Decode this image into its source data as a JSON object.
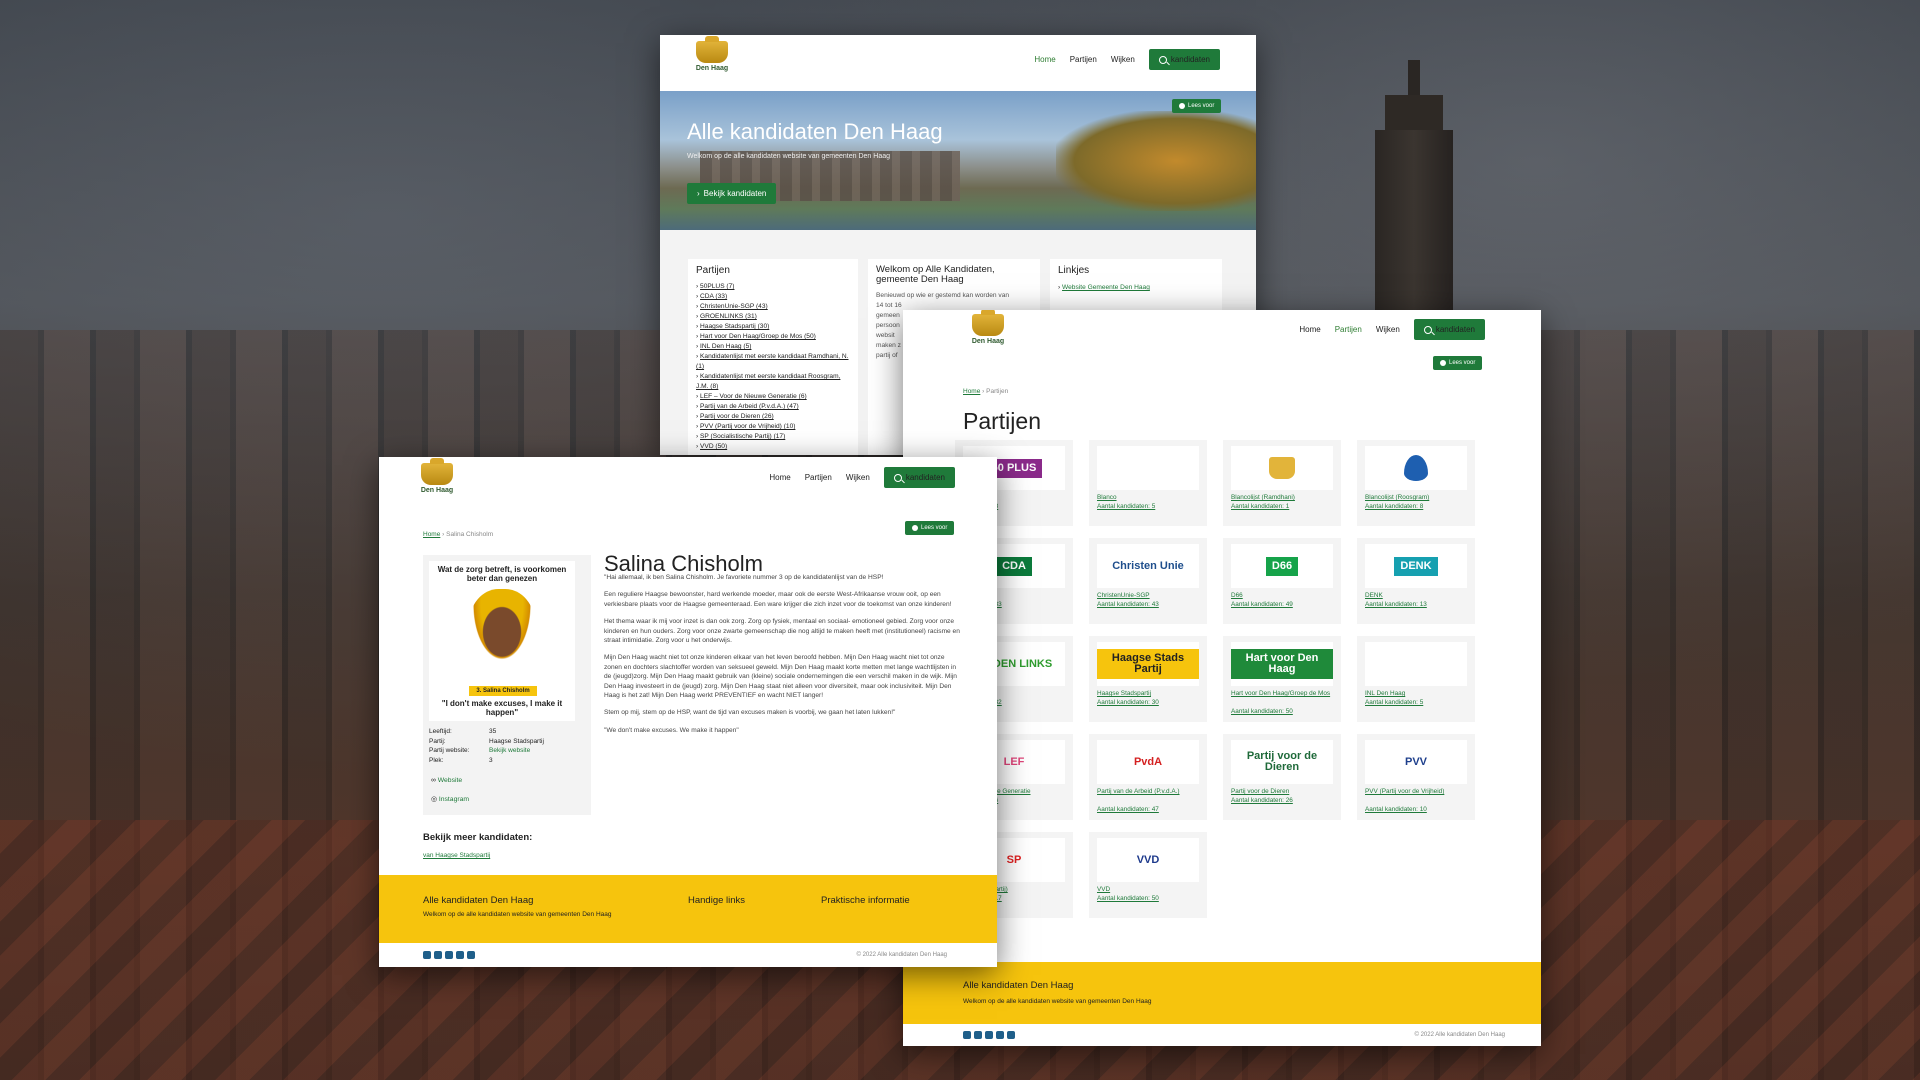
{
  "brand": {
    "logo_text": "Den Haag",
    "accent": "#1f7a3a",
    "footer_color": "#f6c40d"
  },
  "nav": {
    "home": "Home",
    "partijen": "Partijen",
    "wijken": "Wijken",
    "search_button": "kandidaten",
    "lees_voor": "Lees voor"
  },
  "home_page": {
    "hero_title": "Alle kandidaten Den Haag",
    "hero_sub": "Welkom op de alle kandidaten website van gemeenten Den Haag",
    "hero_button": "Bekijk kandidaten",
    "partijen_title": "Partijen",
    "party_list": [
      "50PLUS (7)",
      "CDA (33)",
      "ChristenUnie-SGP (43)",
      "GROENLINKS (31)",
      "Haagse Stadspartij (30)",
      "Hart voor Den Haag/Groep de Mos (50)",
      "INL Den Haag (5)",
      "Kandidatenlijst met eerste kandidaat Ramdhani, N. (1)",
      "Kandidatenlijst met eerste kandidaat Roosgram, J.M. (8)",
      "LEF – Voor de Nieuwe Generatie (6)",
      "Partij van de Arbeid (P.v.d.A.) (47)",
      "Partij voor de Dieren (26)",
      "PVV (Partij voor de Vrijheid) (10)",
      "SP (Socialistische Partij) (17)",
      "VVD (50)"
    ],
    "welkom_title": "Welkom op Alle Kandidaten, gemeente Den Haag",
    "welkom_text": [
      "Benieuwd op wie er gestemd kan worden van",
      "14 tot 16",
      "gemeen",
      "persoon",
      "websit",
      "maken z",
      "partij of"
    ],
    "linkjes_title": "Linkjes",
    "linkjes": [
      "Website Gemeente Den Haag"
    ]
  },
  "partijen_page": {
    "breadcrumb_home": "Home",
    "breadcrumb_current": "Partijen",
    "title": "Partijen",
    "parties": [
      {
        "logo": "50 PLUS",
        "name": "",
        "count": "andidaten: 8"
      },
      {
        "logo": "",
        "name": "Blanco",
        "count": "Aantal kandidaten: 5"
      },
      {
        "logo": "crest",
        "name": "Blancolijst (Ramdhani)",
        "count": "Aantal kandidaten: 1"
      },
      {
        "logo": "flame",
        "name": "Blancolijst (Roosgram)",
        "count": "Aantal kandidaten: 8"
      },
      {
        "logo": "CDA",
        "name": "",
        "count": "andidaten: 33"
      },
      {
        "logo": "Christen Unie",
        "name": "ChristenUnie-SGP",
        "count": "Aantal kandidaten: 43"
      },
      {
        "logo": "D66",
        "name": "D66",
        "count": "Aantal kandidaten: 49"
      },
      {
        "logo": "DENK",
        "name": "DENK",
        "count": "Aantal kandidaten: 13"
      },
      {
        "logo": "GROEN LINKS",
        "name": "LINKS",
        "count": "andidaten: 32"
      },
      {
        "logo": "Haagse Stads Partij",
        "name": "Haagse Stadspartij",
        "count": "Aantal kandidaten: 30"
      },
      {
        "logo": "Hart voor Den Haag",
        "name": "Hart voor Den Haag/Groep de Mos",
        "count": "Aantal kandidaten: 50"
      },
      {
        "logo": "",
        "name": "INL Den Haag",
        "count": "Aantal kandidaten: 5"
      },
      {
        "logo": "LEF",
        "name": "or de Nieuwe Generatie",
        "count": "andidaten: 6"
      },
      {
        "logo": "PvdA",
        "name": "Partij van de Arbeid (P.v.d.A.)",
        "count": "Aantal kandidaten: 47"
      },
      {
        "logo": "Partij voor de Dieren",
        "name": "Partij voor de Dieren",
        "count": "Aantal kandidaten: 26"
      },
      {
        "logo": "PVV",
        "name": "PVV (Partij voor de Vrijheid)",
        "count": "Aantal kandidaten: 10"
      },
      {
        "logo": "SP",
        "name": "alistische Partij)",
        "count": "andidaten: 17"
      },
      {
        "logo": "VVD",
        "name": "VVD",
        "count": "Aantal kandidaten: 50"
      }
    ],
    "footer_title": "Alle kandidaten Den Haag",
    "footer_sub": "Welkom op de alle kandidaten website van gemeenten Den Haag",
    "copyright": "© 2022 Alle kandidaten Den Haag"
  },
  "candidate_page": {
    "breadcrumb_home": "Home",
    "breadcrumb_current": "Salina Chisholm",
    "poster_top": "Wat de zorg betreft, is voorkomen beter dan genezen",
    "poster_tag": "3. Salina Chisholm",
    "poster_quote": "\"I don't make excuses, I make it happen\"",
    "details": [
      {
        "label": "Leeftijd:",
        "value": "35"
      },
      {
        "label": "Partij:",
        "value": "Haagse Stadspartij"
      },
      {
        "label": "Partij website:",
        "value": "Bekijk website"
      },
      {
        "label": "Plek:",
        "value": "3"
      }
    ],
    "website_link": "Website",
    "instagram_link": "Instagram",
    "name": "Salina Chisholm",
    "paragraphs": [
      "\"Hai allemaal, ik ben Salina Chisholm. Je favoriete nummer 3 op de kandidatenlijst van de HSP!",
      "Een reguliere Haagse bewoonster, hard werkende moeder, maar ook de eerste West-Afrikaanse vrouw ooit, op een verkiesbare plaats voor de Haagse gemeenteraad. Een ware krijger die zich inzet voor de toekomst van onze kinderen!",
      "Het thema waar ik mij voor inzet is dan ook zorg. Zorg op fysiek, mentaal en sociaal- emotioneel gebied. Zorg voor onze kinderen en hun ouders. Zorg voor onze zwarte gemeenschap die nog altijd te maken heeft met (institutioneel) racisme en straat intimidatie. Zorg voor u het onderwijs.",
      "Mijn Den Haag wacht niet tot onze kinderen elkaar van het leven beroofd hebben. Mijn Den Haag wacht niet tot onze zonen en dochters slachtoffer worden van seksueel geweld. Mijn Den Haag maakt korte metten met lange wachtlijsten in de (jeugd)zorg. Mijn Den Haag maakt gebruik van (kleine) sociale ondernemingen die een verschil maken in de wijk. Mijn Den Haag investeert in de (jeugd) zorg. Mijn Den Haag staat niet alleen voor diversiteit, maar ook inclusiviteit. Mijn Den Haag is het zat! Mijn Den Haag werkt PREVENTIEF en wacht NIET langer!",
      "Stem op mij, stem op de HSP, want de tijd van excuses maken is voorbij, we gaan het laten lukken!\"",
      "\"We don't make excuses. We make it happen\""
    ],
    "meer_title": "Bekijk meer kandidaten:",
    "meer_link": "van Haagse Stadspartij",
    "footer_title": "Alle kandidaten Den Haag",
    "footer_sub": "Welkom op de alle kandidaten website van gemeenten Den Haag",
    "footer_col2": "Handige links",
    "footer_col3": "Praktische informatie",
    "copyright": "© 2022 Alle kandidaten Den Haag"
  }
}
